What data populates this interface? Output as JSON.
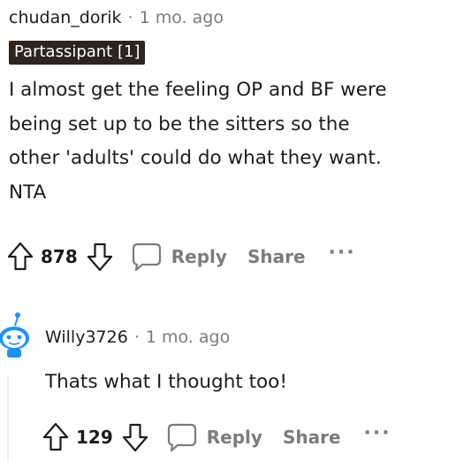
{
  "comments": [
    {
      "author": "chudan_dorik",
      "separator": "·",
      "time": "1 mo. ago",
      "flair": "Partassipant [1]",
      "body_lines": [
        "I almost get the feeling OP and BF were",
        "being set up to be the sitters so the",
        "other 'adults' could do what they want.",
        "NTA"
      ],
      "votes": "878",
      "reply_label": "Reply",
      "share_label": "Share",
      "more_label": "···"
    },
    {
      "author": "Willy3726",
      "separator": "·",
      "time": "1 mo. ago",
      "body": "Thats what I thought too!",
      "votes": "129",
      "reply_label": "Reply",
      "share_label": "Share",
      "more_label": "···"
    }
  ],
  "icons": {
    "upvote": "upvote-arrow-icon",
    "downvote": "downvote-arrow-icon",
    "reply": "speech-bubble-icon",
    "more": "ellipsis-icon",
    "avatar": "snoo-avatar-icon"
  },
  "colors": {
    "text": "#1c1c1c",
    "muted": "#7c7c7c",
    "flair_bg": "#2b2420",
    "avatar_blue": "#1e90ff"
  }
}
